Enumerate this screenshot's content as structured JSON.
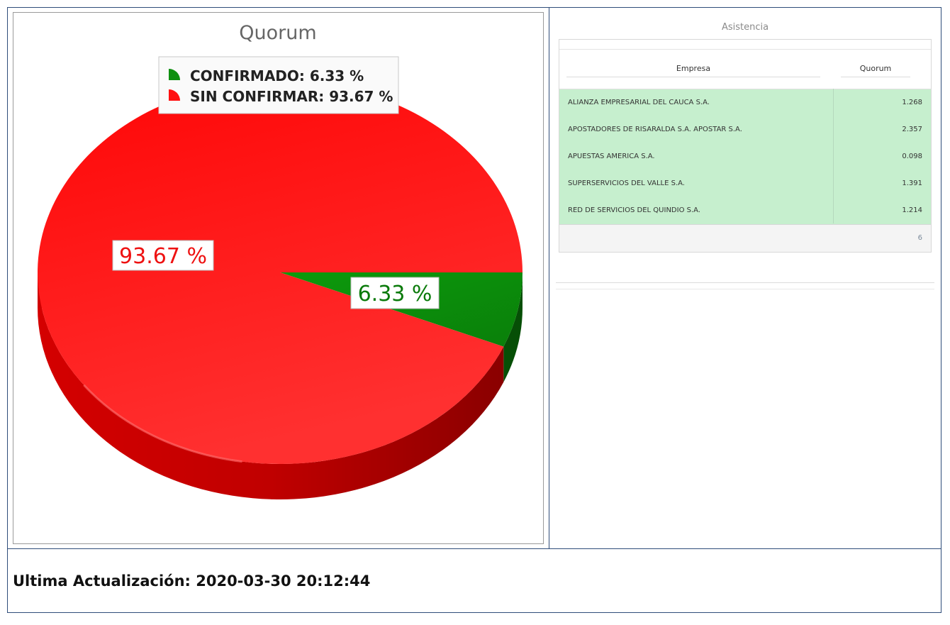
{
  "chart_data": {
    "type": "pie",
    "title": "Quorum",
    "series": [
      {
        "name": "CONFIRMADO",
        "value": 6.33,
        "color": "#0f8f10"
      },
      {
        "name": "SIN CONFIRMAR",
        "value": 93.67,
        "color": "#ff1010"
      }
    ],
    "legend_position": "top",
    "legend_labels": [
      "CONFIRMADO: 6.33 %",
      "SIN CONFIRMAR: 93.67 %"
    ],
    "data_labels": [
      "6.33 %",
      "93.67 %"
    ]
  },
  "grid": {
    "title": "Asistencia",
    "headers": [
      "Empresa",
      "Quorum"
    ],
    "rows": [
      {
        "empresa": "ALIANZA EMPRESARIAL DEL CAUCA S.A.",
        "quorum": "1.268"
      },
      {
        "empresa": "APOSTADORES DE RISARALDA S.A. APOSTAR S.A.",
        "quorum": "2.357"
      },
      {
        "empresa": "APUESTAS AMERICA S.A.",
        "quorum": "0.098"
      },
      {
        "empresa": "SUPERSERVICIOS DEL VALLE S.A.",
        "quorum": "1.391"
      },
      {
        "empresa": "RED DE SERVICIOS DEL QUINDIO S.A.",
        "quorum": "1.214"
      }
    ],
    "footer_count": "6"
  },
  "footer": {
    "label": "Ultima Actualización: 2020-03-30 20:12:44"
  },
  "colors": {
    "border": "#2f4d7a",
    "row_bg": "#c6efce"
  }
}
